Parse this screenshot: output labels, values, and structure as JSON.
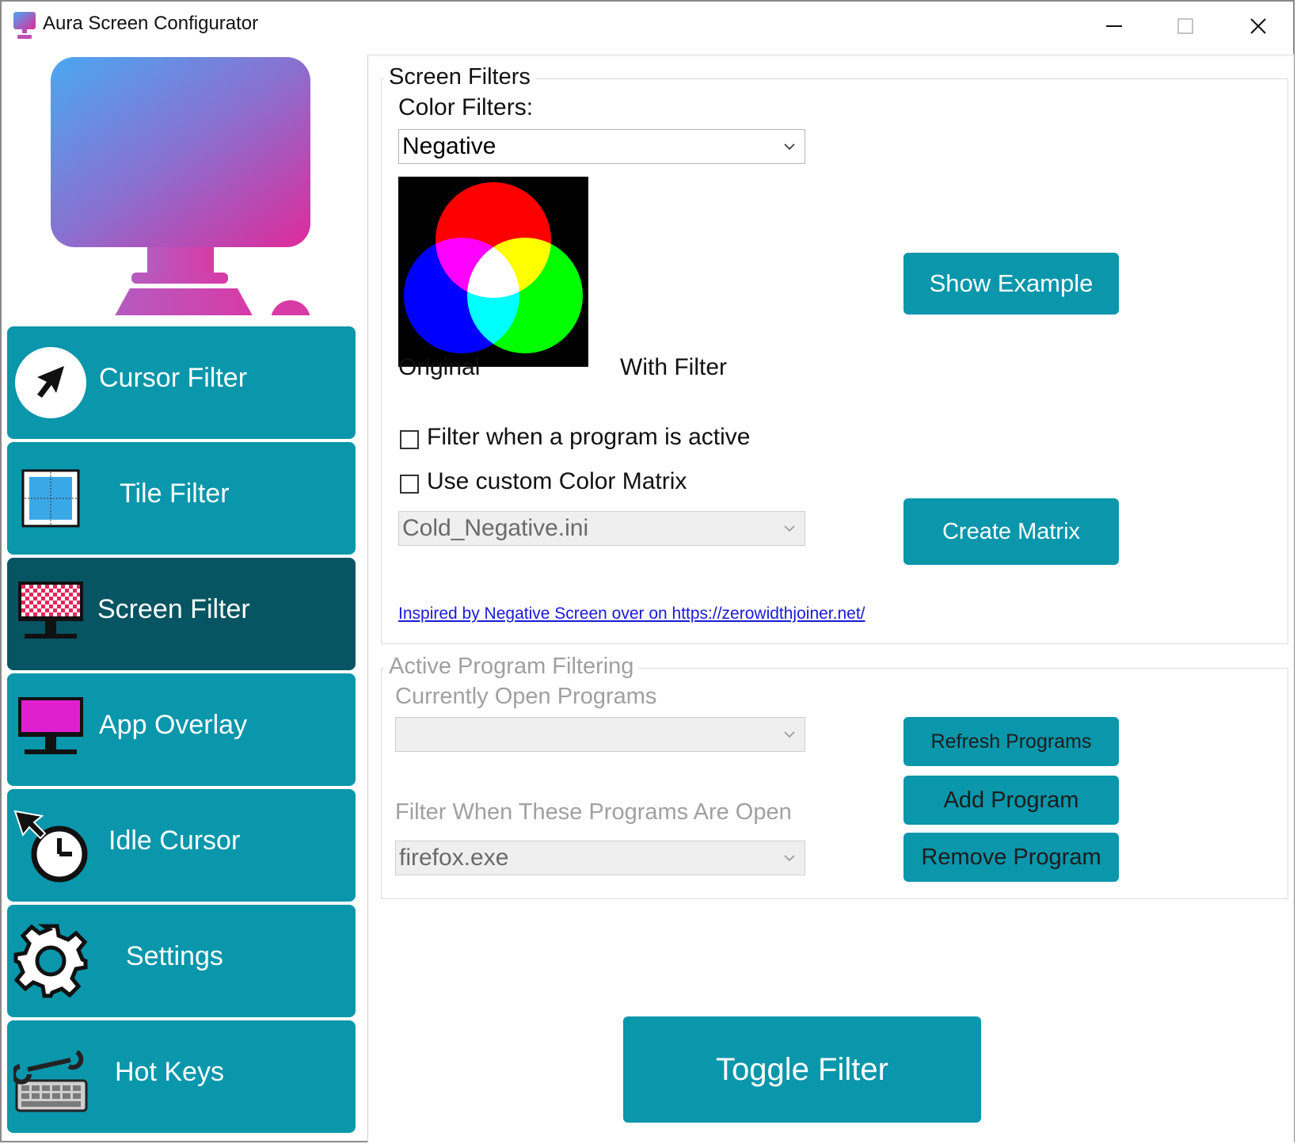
{
  "window": {
    "title": "Aura Screen Configurator",
    "controls": [
      "minimize",
      "maximize",
      "close"
    ]
  },
  "sidebar": {
    "items": [
      {
        "label": "Cursor Filter",
        "icon": "cursor-arrow-icon",
        "active": false
      },
      {
        "label": "Tile Filter",
        "icon": "tile-icon",
        "active": false
      },
      {
        "label": "Screen Filter",
        "icon": "checkered-monitor-icon",
        "active": true
      },
      {
        "label": "App Overlay",
        "icon": "magenta-monitor-icon",
        "active": false
      },
      {
        "label": "Idle Cursor",
        "icon": "cursor-clock-icon",
        "active": false
      },
      {
        "label": "Settings",
        "icon": "gear-icon",
        "active": false
      },
      {
        "label": "Hot Keys",
        "icon": "wrench-keyboard-icon",
        "active": false
      }
    ]
  },
  "screen_filters": {
    "group_title": "Screen Filters",
    "color_filters_label": "Color Filters:",
    "color_filter_value": "Negative",
    "original_label": "Original",
    "with_filter_label": "With Filter",
    "show_example_label": "Show Example",
    "filter_when_active_label": "Filter when a program is active",
    "filter_when_active_checked": false,
    "custom_matrix_label": "Use custom Color Matrix",
    "custom_matrix_checked": false,
    "matrix_file_value": "Cold_Negative.ini",
    "create_matrix_label": "Create Matrix",
    "inspired_link": "Inspired by Negative Screen over on https://zerowidthjoiner.net/"
  },
  "active_program_filtering": {
    "group_title": "Active Program Filtering",
    "open_programs_label": "Currently Open Programs",
    "open_programs_value": "",
    "refresh_label": "Refresh Programs",
    "filter_programs_label": "Filter When These Programs Are Open",
    "filter_programs_value": "firefox.exe",
    "add_label": "Add Program",
    "remove_label": "Remove Program"
  },
  "toggle_filter_label": "Toggle Filter",
  "colors": {
    "accent": "#0a96ab",
    "active_nav": "#075462"
  }
}
